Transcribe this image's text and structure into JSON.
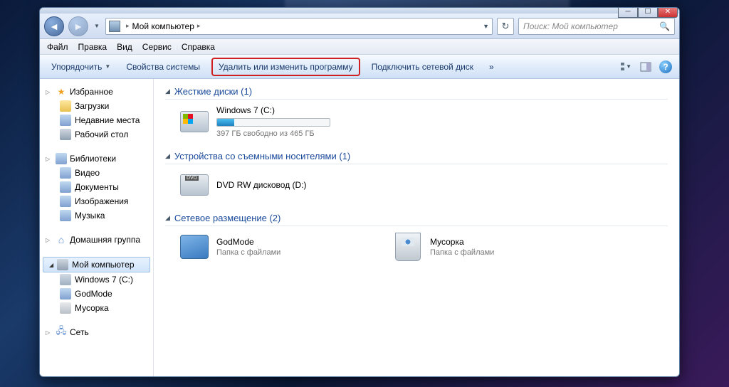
{
  "address": {
    "root": "Мой компьютер"
  },
  "search": {
    "placeholder": "Поиск: Мой компьютер"
  },
  "menu": [
    "Файл",
    "Правка",
    "Вид",
    "Сервис",
    "Справка"
  ],
  "toolbar": {
    "organize": "Упорядочить",
    "props": "Свойства системы",
    "uninstall": "Удалить или изменить программу",
    "netdrive": "Подключить сетевой диск",
    "more": "»"
  },
  "sidebar": {
    "fav": {
      "head": "Избранное",
      "items": [
        "Загрузки",
        "Недавние места",
        "Рабочий стол"
      ]
    },
    "lib": {
      "head": "Библиотеки",
      "items": [
        "Видео",
        "Документы",
        "Изображения",
        "Музыка"
      ]
    },
    "hg": {
      "head": "Домашняя группа"
    },
    "pc": {
      "head": "Мой компьютер",
      "items": [
        "Windows 7 (C:)",
        "GodMode",
        "Мусорка"
      ]
    },
    "net": {
      "head": "Сеть"
    }
  },
  "cats": {
    "hdd": {
      "title": "Жесткие диски (1)",
      "name": "Windows 7 (C:)",
      "free": "397 ГБ свободно из 465 ГБ"
    },
    "rem": {
      "title": "Устройства со съемными носителями (1)",
      "name": "DVD RW дисковод (D:)"
    },
    "net": {
      "title": "Сетевое размещение (2)",
      "a": {
        "name": "GodMode",
        "sub": "Папка с файлами"
      },
      "b": {
        "name": "Мусорка",
        "sub": "Папка с файлами"
      }
    }
  }
}
